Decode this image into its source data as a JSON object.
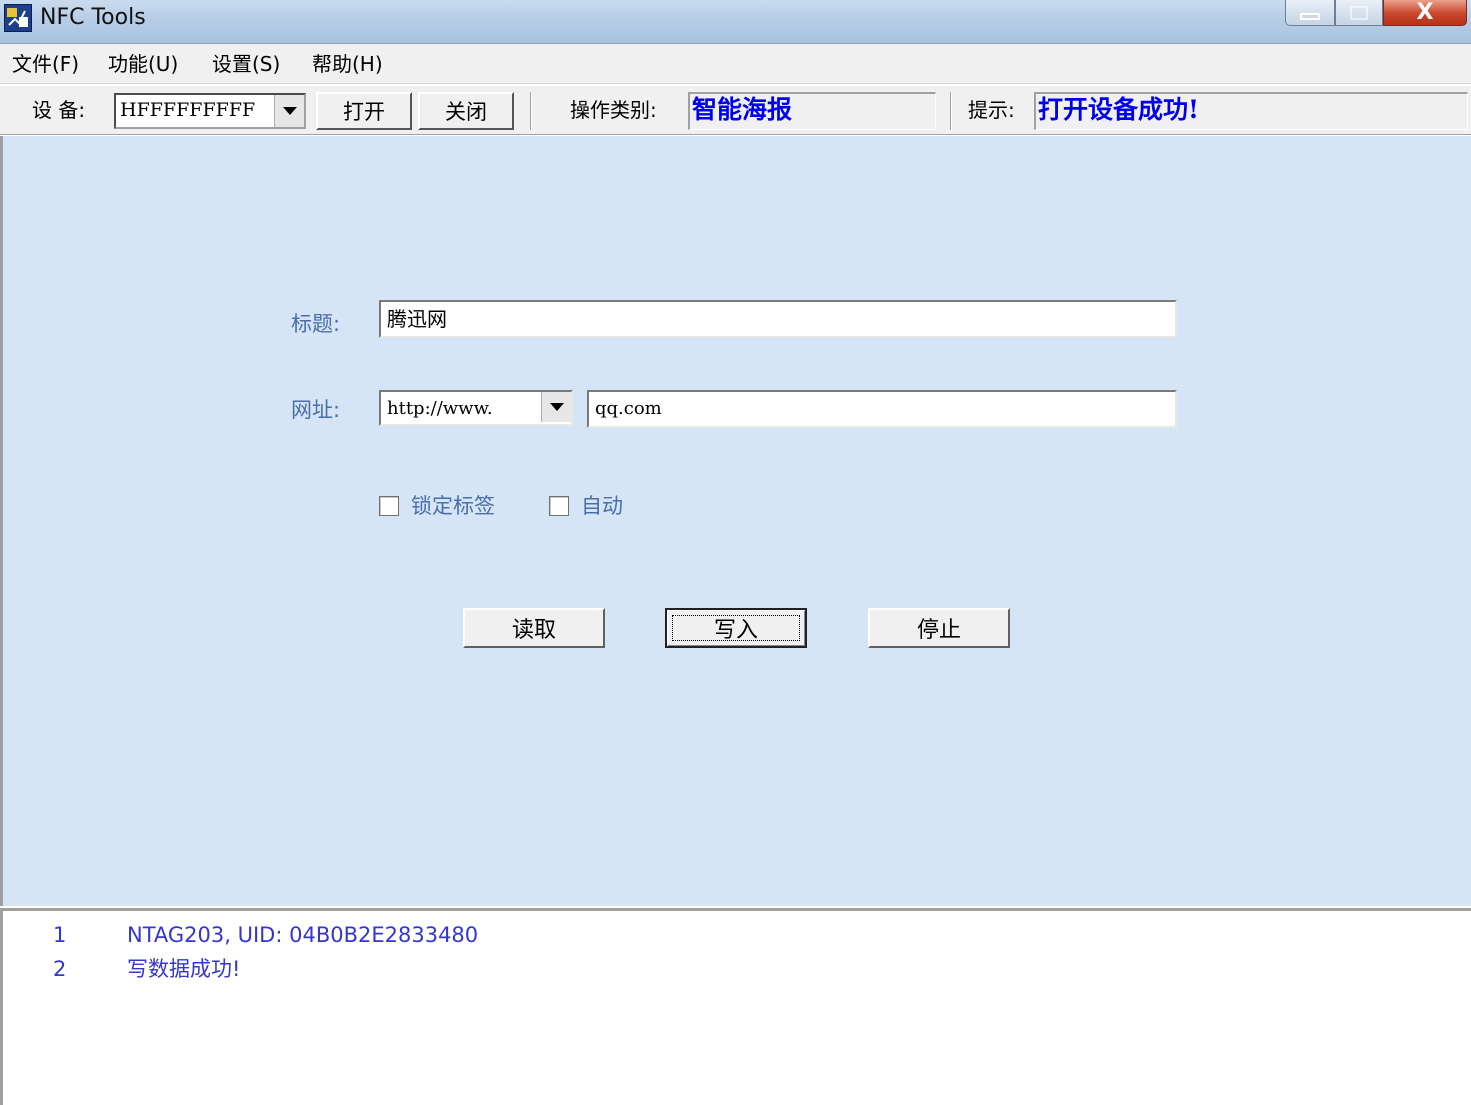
{
  "window": {
    "title": "NFC Tools",
    "close_glyph": "X",
    "accent_color": "#0000ee"
  },
  "menu": [
    {
      "label": "文件(F)"
    },
    {
      "label": "功能(U)"
    },
    {
      "label": "设置(S)"
    },
    {
      "label": "帮助(H)"
    }
  ],
  "toolbar": {
    "device_label": "设 备:",
    "device_value": "HFFFFFFFFF",
    "open_label": "打开",
    "close_label": "关闭",
    "op_type_label": "操作类别:",
    "op_type_value": "智能海报",
    "hint_label": "提示:",
    "hint_value": "打开设备成功!"
  },
  "form": {
    "title_label": "标题:",
    "title_value": "腾迅网",
    "url_label": "网址:",
    "url_prefix": "http://www.",
    "url_value": "qq.com",
    "lock_label": "锁定标签",
    "lock_checked": false,
    "auto_label": "自动",
    "auto_checked": false
  },
  "actions": {
    "read_label": "读取",
    "write_label": "写入",
    "stop_label": "停止"
  },
  "log": [
    {
      "num": "1",
      "message": "NTAG203, UID: 04B0B2E2833480"
    },
    {
      "num": "2",
      "message": "写数据成功!"
    }
  ]
}
